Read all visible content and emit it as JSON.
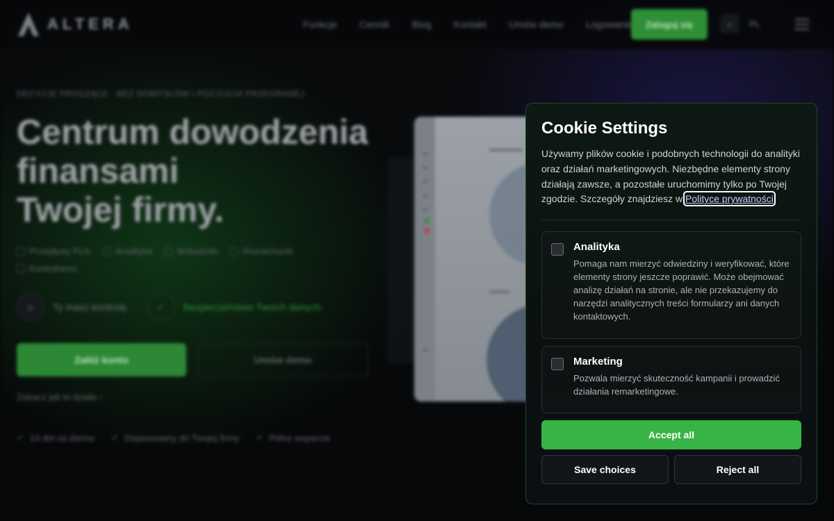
{
  "background": {
    "logo_text": "ALTERA",
    "nav_links": [
      "Funkcje",
      "Cennik",
      "Blog",
      "Kontakt",
      "Umów demo",
      "Logowanie"
    ],
    "nav_cta": "Zaloguj się",
    "nav_lang": "PL",
    "eyebrow": "DECYZJE PROSZĄCE · BEZ DOMYSŁÓW I POCZUCIA PRZEGRANEJ",
    "hero_title_line1": "Centrum dowodzenia",
    "hero_title_line2": "finansami",
    "hero_title_line3": "Twojej firmy.",
    "features": [
      "Przepływy PLN",
      "Analityka",
      "Wskaźniki",
      "Rozrachunki",
      "Kontrahenci"
    ],
    "badge_left": "Ty masz kontrolę.",
    "badge_right": "Bezpieczeństwo Twoich danych.",
    "btn_primary": "Załóż konto",
    "btn_secondary": "Umów demo",
    "link": "Zobacz jak to działa",
    "checks": [
      "14 dni za darmo",
      "Dopasowany do Twojej firmy",
      "Pełne wsparcie"
    ]
  },
  "cookie": {
    "title": "Cookie Settings",
    "description": "Używamy plików cookie i podobnych technologii do analityki oraz działań marketingowych. Niezbędne elementy strony działają zawsze, a pozostałe uruchomimy tylko po Twojej zgodzie. Szczegóły znajdziesz w ",
    "policy_link": "Polityce prywatności",
    "options": [
      {
        "name": "Analityka",
        "text": "Pomaga nam mierzyć odwiedziny i weryfikować, które elementy strony jeszcze poprawić. Może obejmować analizę działań na stronie, ale nie przekazujemy do narzędzi analitycznych treści formularzy ani danych kontaktowych.",
        "checked": false
      },
      {
        "name": "Marketing",
        "text": "Pozwala mierzyć skuteczność kampanii i prowadzić działania remarketingowe.",
        "checked": false
      }
    ],
    "accept_all": "Accept all",
    "save_choices": "Save choices",
    "reject_all": "Reject all",
    "accent_color": "#37b445"
  }
}
